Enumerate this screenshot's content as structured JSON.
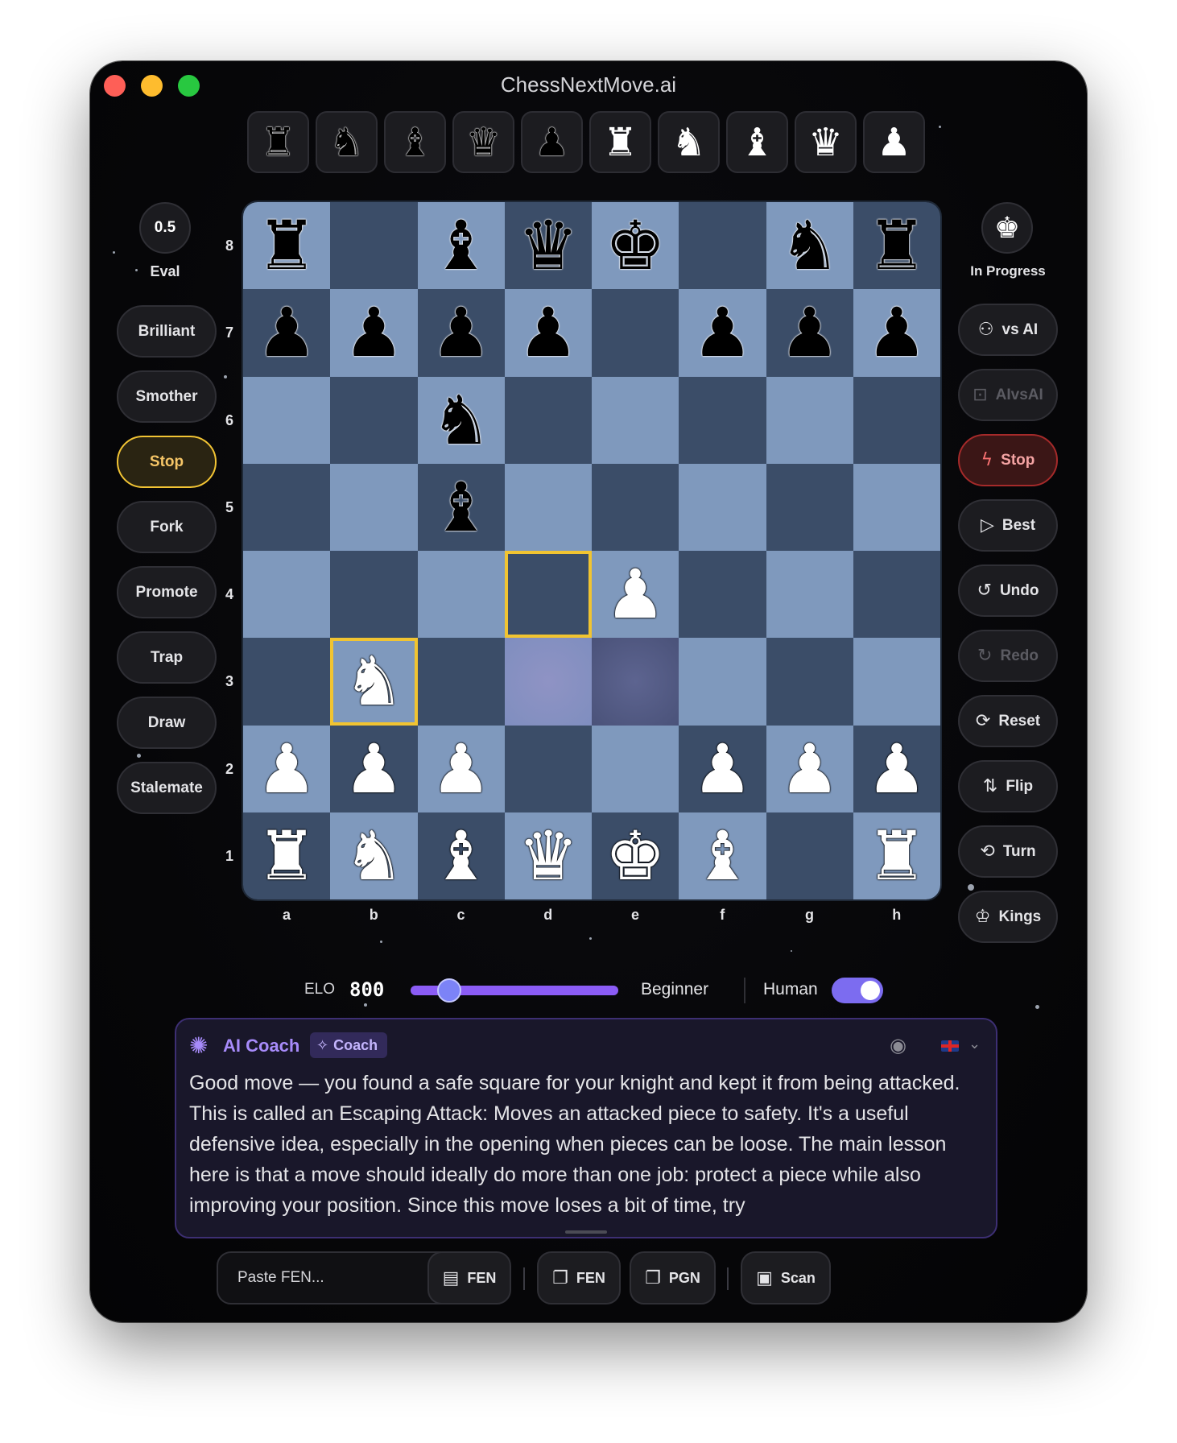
{
  "window": {
    "title": "ChessNextMove.ai"
  },
  "palette": [
    {
      "icon": "black-rook-icon",
      "glyph": "♜",
      "color": "black"
    },
    {
      "icon": "black-knight-icon",
      "glyph": "♞",
      "color": "black"
    },
    {
      "icon": "black-bishop-icon",
      "glyph": "♝",
      "color": "black"
    },
    {
      "icon": "black-queen-icon",
      "glyph": "♛",
      "color": "black"
    },
    {
      "icon": "black-pawn-icon",
      "glyph": "♟",
      "color": "black"
    },
    {
      "icon": "white-rook-icon",
      "glyph": "♜",
      "color": "white"
    },
    {
      "icon": "white-knight-icon",
      "glyph": "♞",
      "color": "white"
    },
    {
      "icon": "white-bishop-icon",
      "glyph": "♝",
      "color": "white"
    },
    {
      "icon": "white-queen-icon",
      "glyph": "♛",
      "color": "white"
    },
    {
      "icon": "white-pawn-icon",
      "glyph": "♟",
      "color": "white"
    }
  ],
  "eval": {
    "value": "0.5",
    "label": "Eval"
  },
  "left_buttons": [
    {
      "label": "Brilliant",
      "active": false
    },
    {
      "label": "Smother",
      "active": false
    },
    {
      "label": "Stop",
      "active": true
    },
    {
      "label": "Fork",
      "active": false
    },
    {
      "label": "Promote",
      "active": false
    },
    {
      "label": "Trap",
      "active": false
    },
    {
      "label": "Draw",
      "active": false
    },
    {
      "label": "Stalemate",
      "active": false
    }
  ],
  "board": {
    "ranks": [
      "8",
      "7",
      "6",
      "5",
      "4",
      "3",
      "2",
      "1"
    ],
    "files": [
      "a",
      "b",
      "c",
      "d",
      "e",
      "f",
      "g",
      "h"
    ],
    "rows": [
      [
        "r",
        "",
        "b",
        "q",
        "k",
        "",
        "n",
        "r"
      ],
      [
        "p",
        "p",
        "p",
        "p",
        "",
        "p",
        "p",
        "p"
      ],
      [
        "",
        "",
        "n",
        "",
        "",
        "",
        "",
        ""
      ],
      [
        "",
        "",
        "b",
        "",
        "",
        "",
        "",
        ""
      ],
      [
        "",
        "",
        "",
        "",
        "P",
        "",
        "",
        ""
      ],
      [
        "",
        "N",
        "",
        "",
        "",
        "",
        "",
        ""
      ],
      [
        "P",
        "P",
        "P",
        "",
        "",
        "P",
        "P",
        "P"
      ],
      [
        "R",
        "N",
        "B",
        "Q",
        "K",
        "B",
        "",
        "R"
      ]
    ],
    "highlighted": [
      "d4",
      "b3"
    ],
    "glow": [
      "d3",
      "e3"
    ],
    "light_square_color": "#7f99bd",
    "dark_square_color": "#3b4d68",
    "highlight_color": "#f1c431"
  },
  "status": {
    "icon": "white-king-icon",
    "glyph": "♚",
    "label": "In Progress"
  },
  "right_buttons": [
    {
      "label": "vs AI",
      "icon": "user-icon",
      "glyph": "⚇",
      "state": "normal"
    },
    {
      "label": "AIvsAI",
      "icon": "robot-icon",
      "glyph": "⊡",
      "state": "disabled"
    },
    {
      "label": "Stop",
      "icon": "lightning-icon",
      "glyph": "ϟ",
      "state": "danger"
    },
    {
      "label": "Best",
      "icon": "play-icon",
      "glyph": "▷",
      "state": "normal"
    },
    {
      "label": "Undo",
      "icon": "undo-icon",
      "glyph": "↺",
      "state": "normal"
    },
    {
      "label": "Redo",
      "icon": "redo-icon",
      "glyph": "↻",
      "state": "disabled"
    },
    {
      "label": "Reset",
      "icon": "refresh-icon",
      "glyph": "⟳",
      "state": "normal"
    },
    {
      "label": "Flip",
      "icon": "flip-icon",
      "glyph": "⇅",
      "state": "normal"
    },
    {
      "label": "Turn",
      "icon": "rotate-icon",
      "glyph": "⟲",
      "state": "normal"
    },
    {
      "label": "Kings",
      "icon": "crown-icon",
      "glyph": "♔",
      "state": "normal"
    }
  ],
  "elo": {
    "label": "ELO",
    "value": "800",
    "slider_fraction": 0.12,
    "level": "Beginner",
    "human_label": "Human",
    "human_enabled": true
  },
  "coach": {
    "title": "AI Coach",
    "badge": "Coach",
    "language": "en-GB",
    "text": "Good move — you found a safe square for your knight and kept it from being attacked. This is called an Escaping Attack: Moves an attacked piece to safety. It's a useful defensive idea, especially in the opening when pieces can be loose. The main lesson here is that a move should ideally do more than one job: protect a piece while also improving your position. Since this move loses a bit of time, try"
  },
  "bottom": {
    "fen_placeholder": "Paste FEN...",
    "buttons": [
      {
        "label": "FEN",
        "icon": "document-icon"
      },
      {
        "label": "FEN",
        "icon": "copy-icon"
      },
      {
        "label": "PGN",
        "icon": "copy-icon"
      },
      {
        "label": "Scan",
        "icon": "image-icon"
      }
    ]
  },
  "colors": {
    "accent": "#8b5cf6",
    "coach_border": "#3d2f73",
    "danger": "#a52a2a",
    "active_yellow": "#f2c434"
  }
}
